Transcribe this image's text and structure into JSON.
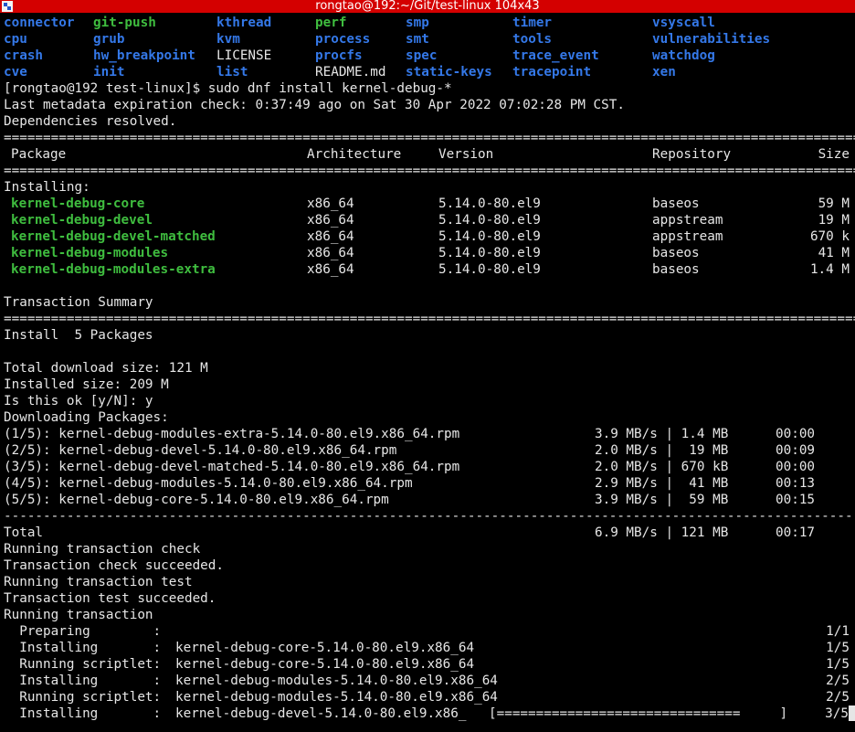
{
  "window": {
    "title": "rongtao@192:~/Git/test-linux 104x43"
  },
  "ls_listing": [
    [
      {
        "t": "connector",
        "k": "dir"
      },
      {
        "t": "git-push",
        "k": "exe"
      },
      {
        "t": "kthread",
        "k": "dir"
      },
      {
        "t": "perf",
        "k": "exe"
      },
      {
        "t": "smp",
        "k": "dir"
      },
      {
        "t": "timer",
        "k": "dir"
      },
      {
        "t": "vsyscall",
        "k": "dir"
      }
    ],
    [
      {
        "t": "cpu",
        "k": "dir"
      },
      {
        "t": "grub",
        "k": "dir"
      },
      {
        "t": "kvm",
        "k": "dir"
      },
      {
        "t": "process",
        "k": "dir"
      },
      {
        "t": "smt",
        "k": "dir"
      },
      {
        "t": "tools",
        "k": "dir"
      },
      {
        "t": "vulnerabilities",
        "k": "dir"
      }
    ],
    [
      {
        "t": "crash",
        "k": "dir"
      },
      {
        "t": "hw_breakpoint",
        "k": "dir"
      },
      {
        "t": "LICENSE",
        "k": "file"
      },
      {
        "t": "procfs",
        "k": "dir"
      },
      {
        "t": "spec",
        "k": "dir"
      },
      {
        "t": "trace_event",
        "k": "dir"
      },
      {
        "t": "watchdog",
        "k": "dir"
      }
    ],
    [
      {
        "t": "cve",
        "k": "dir"
      },
      {
        "t": "init",
        "k": "dir"
      },
      {
        "t": "list",
        "k": "dir"
      },
      {
        "t": "README.md",
        "k": "file"
      },
      {
        "t": "static-keys",
        "k": "dir"
      },
      {
        "t": "tracepoint",
        "k": "dir"
      },
      {
        "t": "xen",
        "k": "dir"
      }
    ]
  ],
  "prompt": "[rongtao@192 test-linux]$ sudo dnf install kernel-debug-*",
  "metadata_line": "Last metadata expiration check: 0:37:49 ago on Sat 30 Apr 2022 07:02:28 PM CST.",
  "deps_line": "Dependencies resolved.",
  "table_headers": {
    "package": "Package",
    "arch": "Architecture",
    "version": "Version",
    "repo": "Repository",
    "size": "Size"
  },
  "installing_label": "Installing:",
  "packages": [
    {
      "name": "kernel-debug-core",
      "arch": "x86_64",
      "version": "5.14.0-80.el9",
      "repo": "baseos",
      "size": "59 M"
    },
    {
      "name": "kernel-debug-devel",
      "arch": "x86_64",
      "version": "5.14.0-80.el9",
      "repo": "appstream",
      "size": "19 M"
    },
    {
      "name": "kernel-debug-devel-matched",
      "arch": "x86_64",
      "version": "5.14.0-80.el9",
      "repo": "appstream",
      "size": "670 k"
    },
    {
      "name": "kernel-debug-modules",
      "arch": "x86_64",
      "version": "5.14.0-80.el9",
      "repo": "baseos",
      "size": "41 M"
    },
    {
      "name": "kernel-debug-modules-extra",
      "arch": "x86_64",
      "version": "5.14.0-80.el9",
      "repo": "baseos",
      "size": "1.4 M"
    }
  ],
  "summary_label": "Transaction Summary",
  "install_count": "Install  5 Packages",
  "download_size": "Total download size: 121 M",
  "installed_size": "Installed size: 209 M",
  "confirm": "Is this ok [y/N]: y",
  "downloading_label": "Downloading Packages:",
  "downloads": [
    {
      "file": "(1/5): kernel-debug-modules-extra-5.14.0-80.el9.x86_64.rpm",
      "speed": "3.9 MB/s | 1.4 MB",
      "time": "00:00"
    },
    {
      "file": "(2/5): kernel-debug-devel-5.14.0-80.el9.x86_64.rpm",
      "speed": "2.0 MB/s |  19 MB",
      "time": "00:09"
    },
    {
      "file": "(3/5): kernel-debug-devel-matched-5.14.0-80.el9.x86_64.rpm",
      "speed": "2.0 MB/s | 670 kB",
      "time": "00:00"
    },
    {
      "file": "(4/5): kernel-debug-modules-5.14.0-80.el9.x86_64.rpm",
      "speed": "2.9 MB/s |  41 MB",
      "time": "00:13"
    },
    {
      "file": "(5/5): kernel-debug-core-5.14.0-80.el9.x86_64.rpm",
      "speed": "3.9 MB/s |  59 MB",
      "time": "00:15"
    }
  ],
  "total": {
    "label": "Total",
    "speed": "6.9 MB/s | 121 MB",
    "time": "00:17"
  },
  "transaction_lines": [
    "Running transaction check",
    "Transaction check succeeded.",
    "Running transaction test",
    "Transaction test succeeded.",
    "Running transaction"
  ],
  "steps": [
    {
      "action": "  Preparing        :",
      "target": "",
      "count": "1/1"
    },
    {
      "action": "  Installing       :",
      "target": "kernel-debug-core-5.14.0-80.el9.x86_64",
      "count": "1/5"
    },
    {
      "action": "  Running scriptlet:",
      "target": "kernel-debug-core-5.14.0-80.el9.x86_64",
      "count": "1/5"
    },
    {
      "action": "  Installing       :",
      "target": "kernel-debug-modules-5.14.0-80.el9.x86_64",
      "count": "2/5"
    },
    {
      "action": "  Running scriptlet:",
      "target": "kernel-debug-modules-5.14.0-80.el9.x86_64",
      "count": "2/5"
    }
  ],
  "progress_step": {
    "action": "  Installing       :",
    "target": "kernel-debug-devel-5.14.0-80.el9.x86_",
    "bar": "[===============================     ]",
    "count": "3/5"
  },
  "sep_double": "==============================================================================================================================",
  "sep_dash": "------------------------------------------------------------------------------------------------------------------------------"
}
